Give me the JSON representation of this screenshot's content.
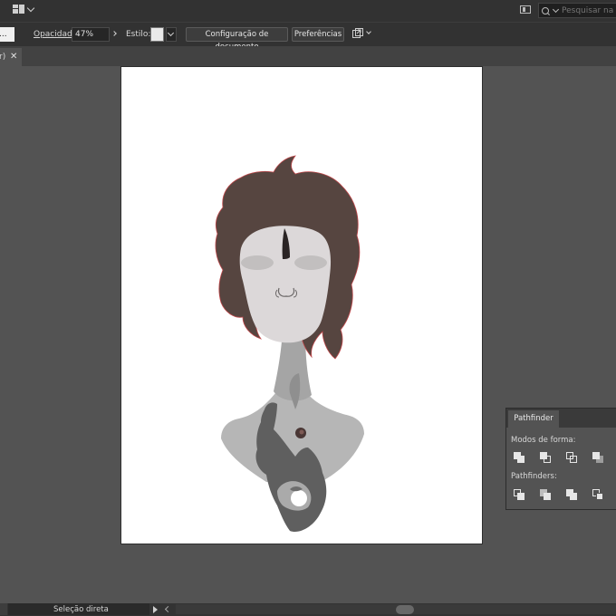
{
  "menubar": {
    "workspace_icon": "workspace-grid-icon",
    "panel_icon": "panel-layout-icon",
    "search": {
      "placeholder": "Pesquisar na Ajuda",
      "icon": "search-icon"
    }
  },
  "control_bar": {
    "cut_dropdown_value": "...",
    "opacity_label": "Opacidade:",
    "opacity_value": "47%",
    "style_label": "Estilo:",
    "doc_setup_label": "Configuração de documento",
    "preferences_label": "Preferências",
    "arrange_icon": "arrange-documents-icon"
  },
  "document_tab": {
    "title_fragment": "r)",
    "close_glyph": "✕"
  },
  "artwork": {
    "colors": {
      "hair": "#564540",
      "hair_outline": "#c0474a",
      "face": "#dcd8d9",
      "body": "#b6b6b6",
      "neck": "#a5a5a5",
      "hand": "#5f5f5f",
      "artboard": "#ffffff",
      "workspace": "#535353"
    }
  },
  "pathfinder": {
    "tab_label": "Pathfinder",
    "shape_modes_label": "Modos de forma:",
    "pathfinders_label": "Pathfinders:",
    "shape_mode_icons": [
      "unite-icon",
      "minus-front-icon",
      "intersect-icon",
      "exclude-icon"
    ],
    "pathfinder_icons": [
      "divide-icon",
      "trim-icon",
      "merge-icon",
      "crop-icon"
    ]
  },
  "status_bar": {
    "tool_name": "Seleção direta"
  }
}
